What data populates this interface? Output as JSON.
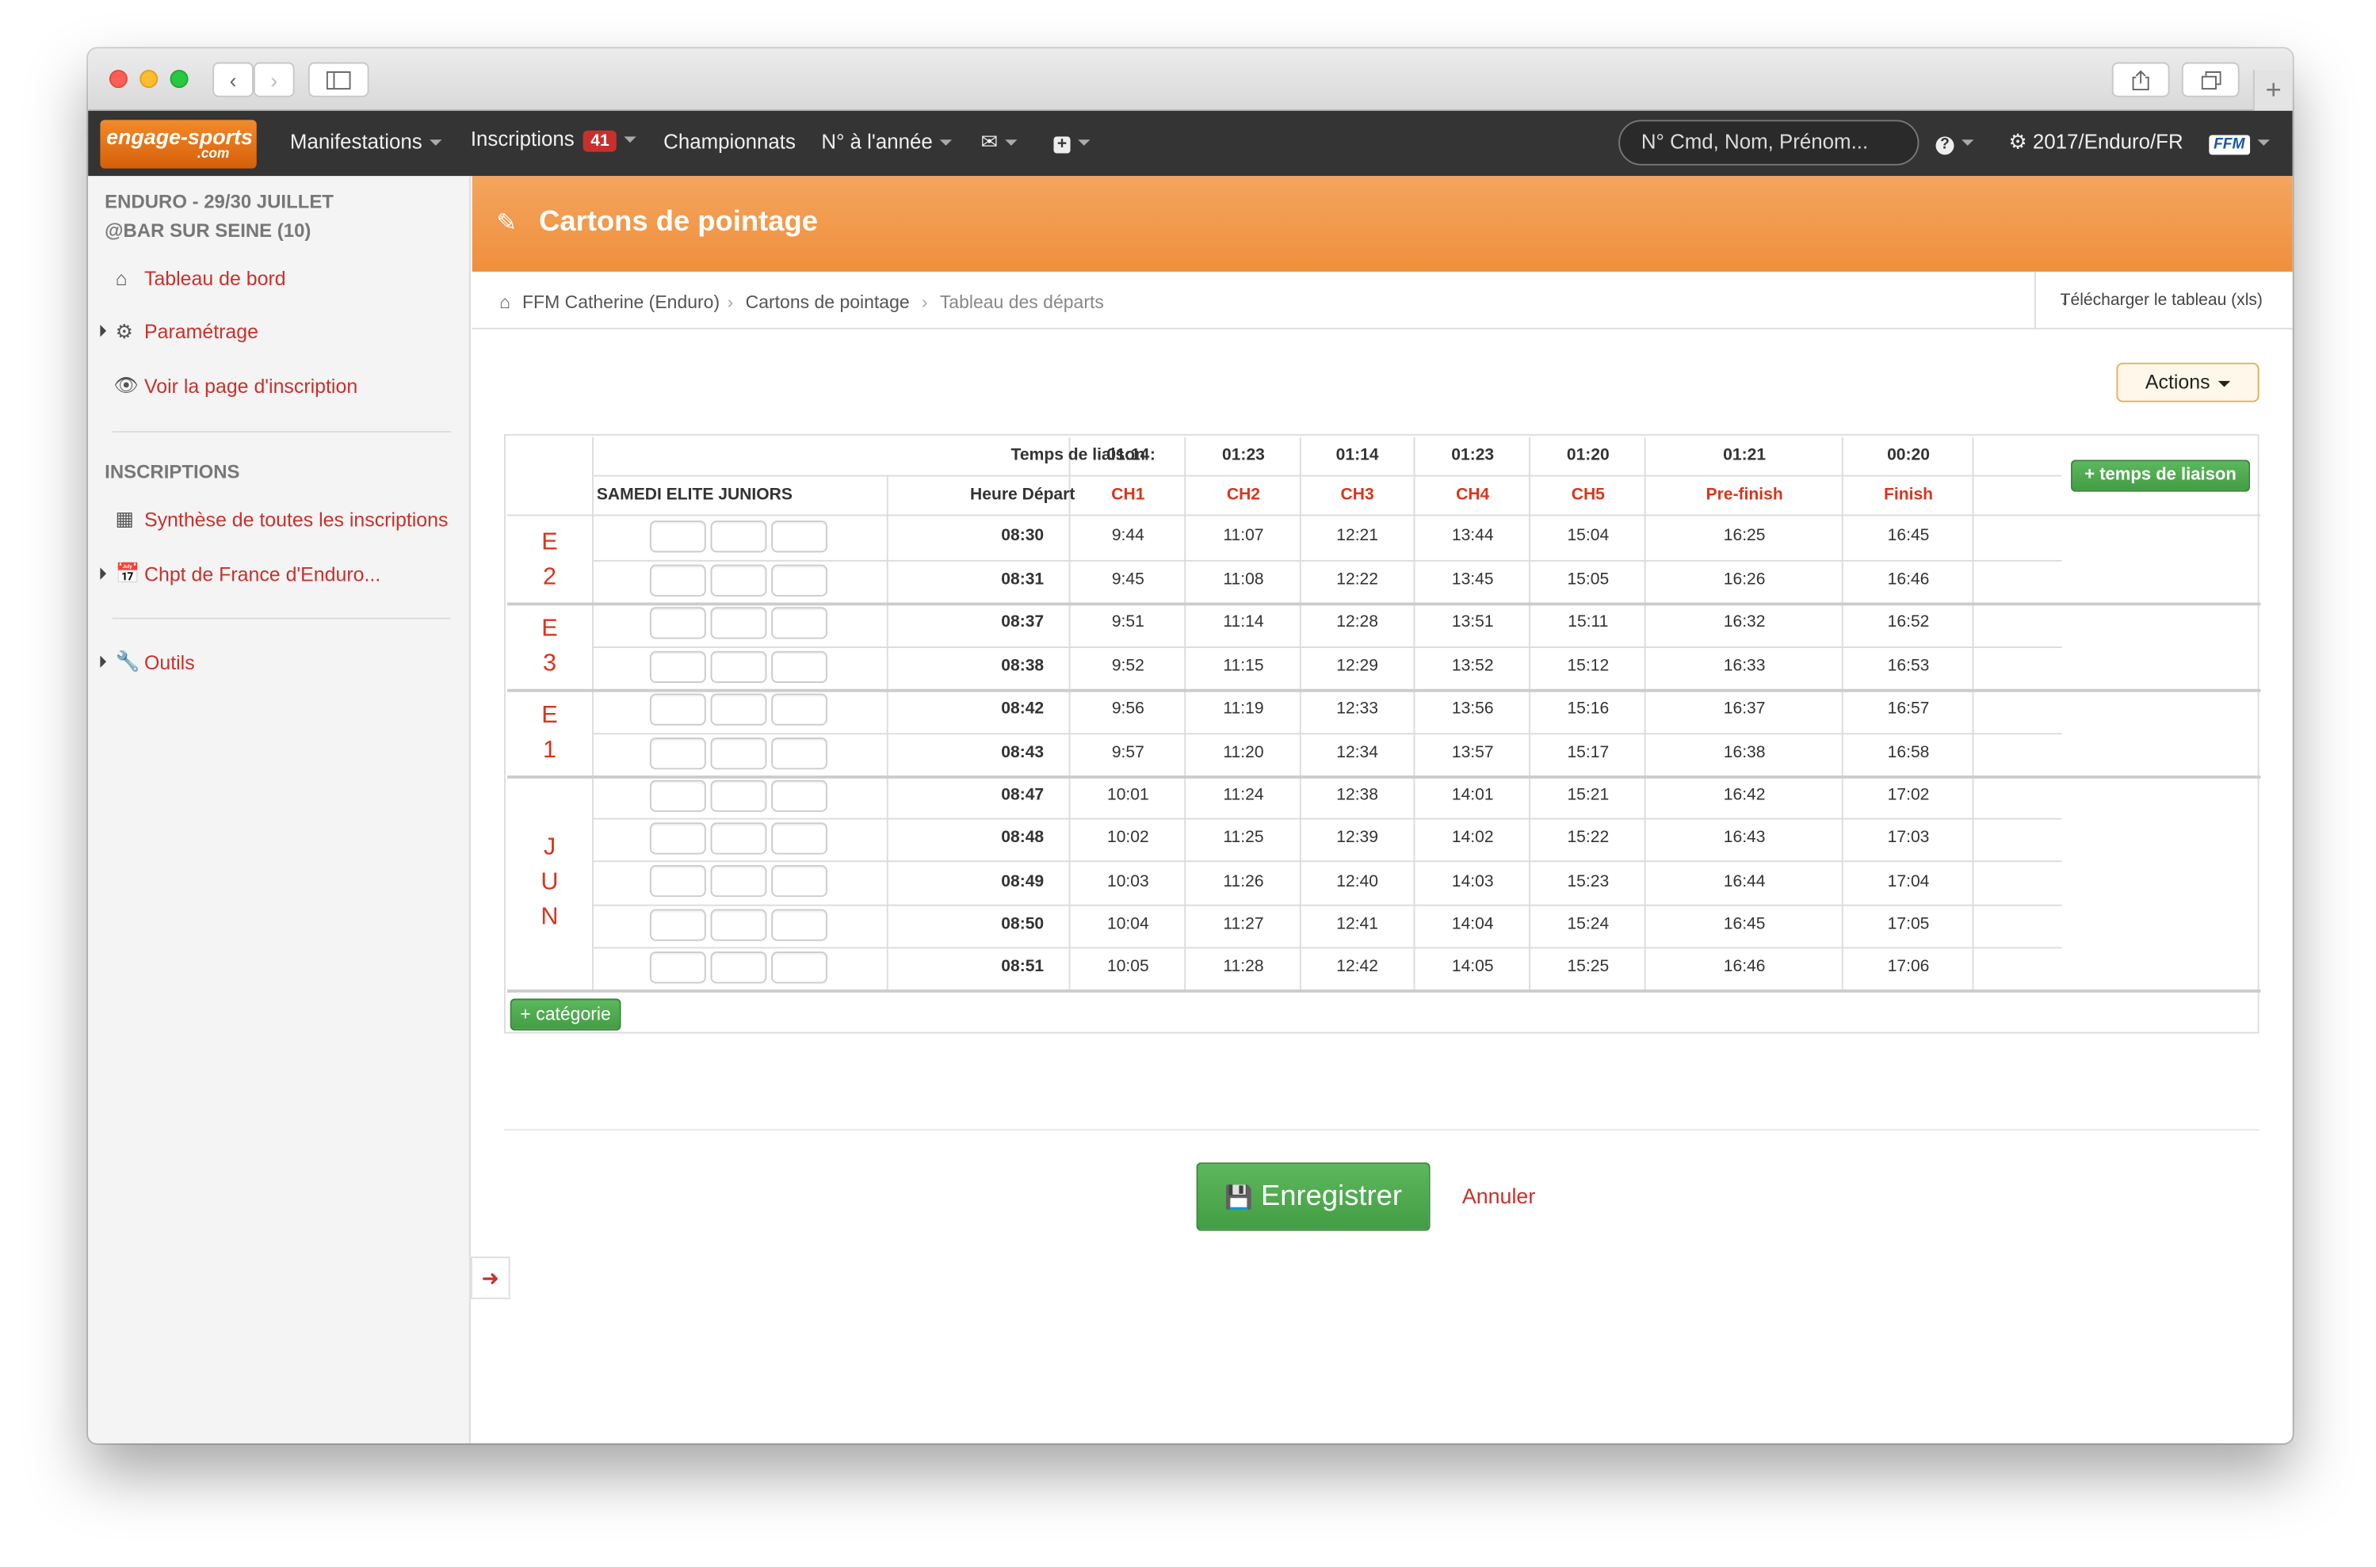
{
  "nav": {
    "logo_main": "engage-sports",
    "logo_sub": ".com",
    "menu": [
      {
        "label": "Manifestations",
        "dropdown": true
      },
      {
        "label": "Inscriptions",
        "badge": "41",
        "dropdown": true
      },
      {
        "label": "Championnats",
        "dropdown": false
      },
      {
        "label": "N° à l'année",
        "dropdown": true
      }
    ],
    "search_placeholder": "N° Cmd, Nom, Prénom...",
    "context": "2017/Enduro/FR",
    "federation_logo": "FFM"
  },
  "sidebar": {
    "event_line1": "ENDURO - 29/30 JUILLET",
    "event_line2": "@BAR SUR SEINE (10)",
    "items": [
      {
        "label": "Tableau de bord",
        "icon": "home-icon"
      },
      {
        "label": "Paramétrage",
        "icon": "gear-icon"
      },
      {
        "label": "Voir la page d'inscription",
        "icon": "eye-icon"
      }
    ],
    "section_heading": "INSCRIPTIONS",
    "section_items": [
      {
        "label": "Synthèse de toutes les inscriptions",
        "icon": "table-icon"
      },
      {
        "label": "Chpt de France d'Enduro...",
        "icon": "calendar-icon"
      }
    ],
    "tools": {
      "label": "Outils",
      "icon": "wrench-icon"
    }
  },
  "page": {
    "title": "Cartons de pointage",
    "breadcrumb": [
      "FFM Catherine (Enduro)",
      "Cartons de pointage",
      "Tableau des départs"
    ],
    "download_label": "Télécharger le tableau (xls)",
    "actions_label": "Actions"
  },
  "table": {
    "liaison_label": "Temps de liaison :",
    "category_title": "SAMEDI ELITE JUNIORS",
    "start_header": "Heure Départ",
    "liaison_times": [
      "01:14",
      "01:23",
      "01:14",
      "01:23",
      "01:20",
      "01:21",
      "00:20"
    ],
    "checkpoints": [
      "CH1",
      "CH2",
      "CH3",
      "CH4",
      "CH5",
      "Pre-finish",
      "Finish"
    ],
    "add_liaison_label": "+ temps de liaison",
    "groups": [
      {
        "label": "E 2",
        "rows": [
          {
            "start": "08:30",
            "times": [
              "9:44",
              "11:07",
              "12:21",
              "13:44",
              "15:04",
              "16:25",
              "16:45"
            ]
          },
          {
            "start": "08:31",
            "times": [
              "9:45",
              "11:08",
              "12:22",
              "13:45",
              "15:05",
              "16:26",
              "16:46"
            ]
          }
        ]
      },
      {
        "label": "E 3",
        "rows": [
          {
            "start": "08:37",
            "times": [
              "9:51",
              "11:14",
              "12:28",
              "13:51",
              "15:11",
              "16:32",
              "16:52"
            ]
          },
          {
            "start": "08:38",
            "times": [
              "9:52",
              "11:15",
              "12:29",
              "13:52",
              "15:12",
              "16:33",
              "16:53"
            ]
          }
        ]
      },
      {
        "label": "E 1",
        "rows": [
          {
            "start": "08:42",
            "times": [
              "9:56",
              "11:19",
              "12:33",
              "13:56",
              "15:16",
              "16:37",
              "16:57"
            ]
          },
          {
            "start": "08:43",
            "times": [
              "9:57",
              "11:20",
              "12:34",
              "13:57",
              "15:17",
              "16:38",
              "16:58"
            ]
          }
        ]
      },
      {
        "label": "J U N",
        "rows": [
          {
            "start": "08:47",
            "times": [
              "10:01",
              "11:24",
              "12:38",
              "14:01",
              "15:21",
              "16:42",
              "17:02"
            ]
          },
          {
            "start": "08:48",
            "times": [
              "10:02",
              "11:25",
              "12:39",
              "14:02",
              "15:22",
              "16:43",
              "17:03"
            ]
          },
          {
            "start": "08:49",
            "times": [
              "10:03",
              "11:26",
              "12:40",
              "14:03",
              "15:23",
              "16:44",
              "17:04"
            ]
          },
          {
            "start": "08:50",
            "times": [
              "10:04",
              "11:27",
              "12:41",
              "14:04",
              "15:24",
              "16:45",
              "17:05"
            ]
          },
          {
            "start": "08:51",
            "times": [
              "10:05",
              "11:28",
              "12:42",
              "14:05",
              "15:25",
              "16:46",
              "17:06"
            ]
          }
        ]
      }
    ],
    "add_category_label": "+ catégorie"
  },
  "form": {
    "save_label": "Enregistrer",
    "cancel_label": "Annuler"
  },
  "colors": {
    "accent_orange": "#ef8f3c",
    "link_red": "#c9302c",
    "checkpoint_red": "#d9351c",
    "button_green": "#5cb85c",
    "navbar": "#343434"
  }
}
